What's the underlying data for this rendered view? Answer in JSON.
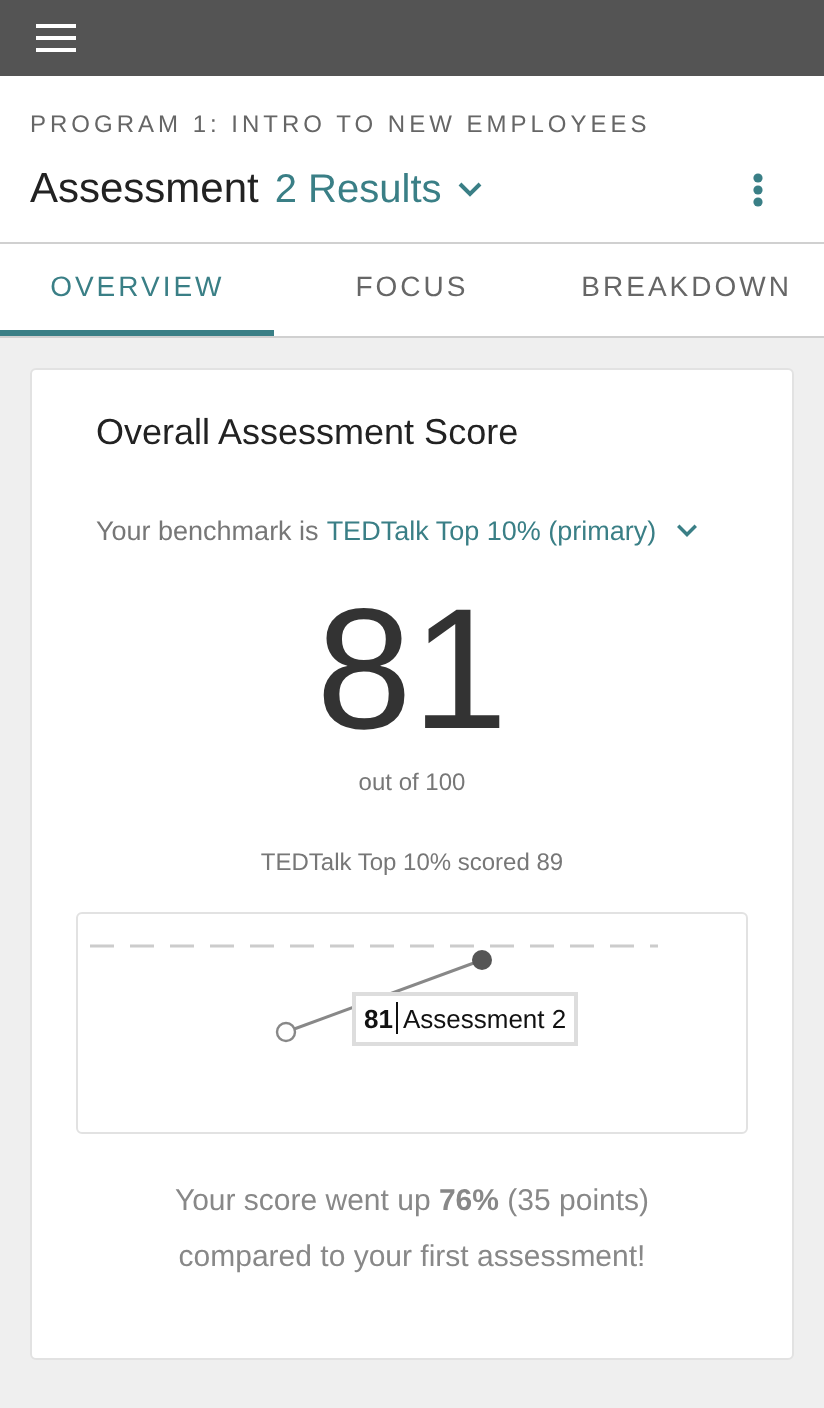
{
  "header": {
    "program": "PROGRAM 1: INTRO TO NEW EMPLOYEES",
    "title": "Assessment",
    "results": "2 Results"
  },
  "tabs": [
    {
      "label": "OVERVIEW",
      "selected": true
    },
    {
      "label": "FOCUS",
      "selected": false
    },
    {
      "label": "BREAKDOWN",
      "selected": false
    }
  ],
  "card": {
    "title": "Overall Assessment Score",
    "benchmark_prefix": "Your benchmark is",
    "benchmark": "TEDTalk Top 10% (primary)",
    "score": "81",
    "out_of": "out of 100",
    "benchmark_score": "TEDTalk Top 10% scored 89",
    "tooltip": {
      "value": "81",
      "label": "Assessment 2"
    },
    "summary": "Your score went up **76%** (35 points) compared to your first assessment!"
  }
}
